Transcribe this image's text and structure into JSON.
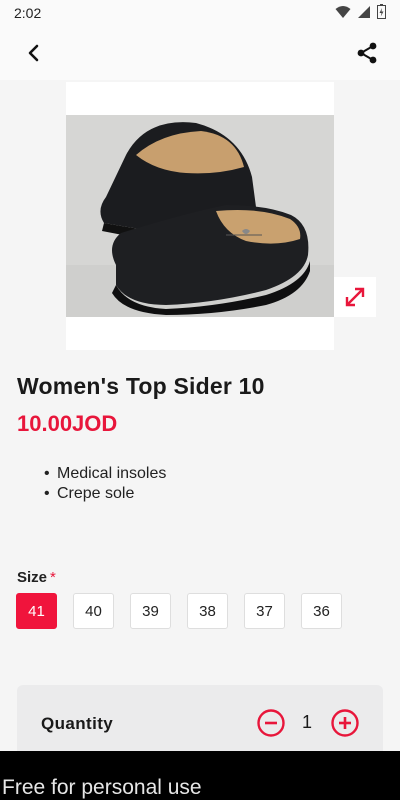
{
  "status_bar": {
    "time": "2:02"
  },
  "appbar": {
    "back_icon": "chevron-left-icon",
    "share_icon": "share-icon"
  },
  "product": {
    "title": "Women's Top Sider 10",
    "price": "10.00JOD",
    "features": [
      "Medical insoles",
      "Crepe sole"
    ],
    "expand_icon": "expand-arrows-icon"
  },
  "size": {
    "label": "Size",
    "required_mark": "*",
    "options": [
      "41",
      "40",
      "39",
      "38",
      "37",
      "36"
    ],
    "selected": "41"
  },
  "quantity": {
    "label": "Quantity",
    "value": "1",
    "minus_icon": "minus-circle-icon",
    "plus_icon": "plus-circle-icon"
  },
  "watermark": {
    "text": "Free for personal use"
  },
  "colors": {
    "accent": "#e8163b",
    "background": "#f5f5f5"
  }
}
